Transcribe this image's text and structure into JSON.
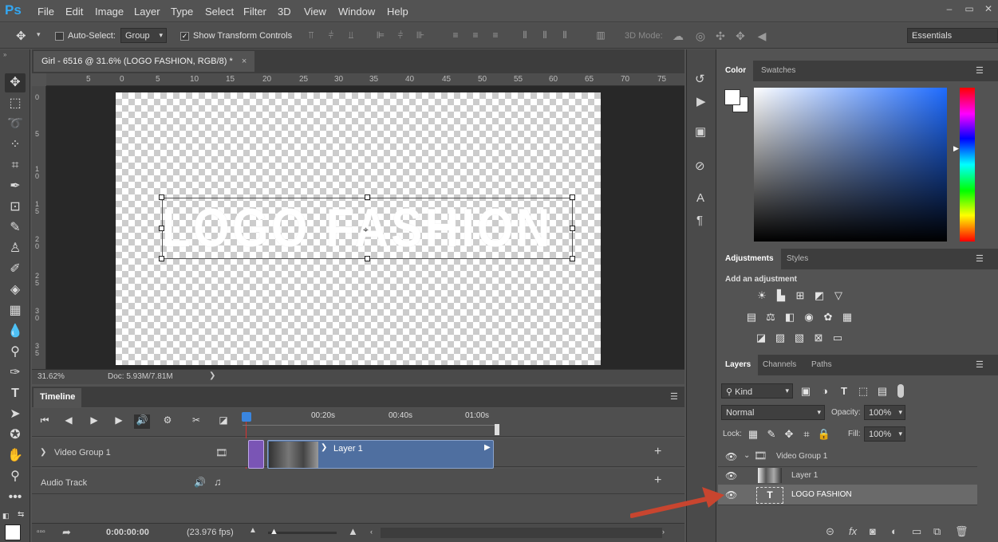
{
  "app": {
    "logo": "Ps"
  },
  "menu": [
    "File",
    "Edit",
    "Image",
    "Layer",
    "Type",
    "Select",
    "Filter",
    "3D",
    "View",
    "Window",
    "Help"
  ],
  "window_controls": [
    "–",
    "▭",
    "✕"
  ],
  "options": {
    "auto_select_label": "Auto-Select:",
    "auto_select_value": "Group",
    "show_transform_label": "Show Transform Controls",
    "mode_3d_label": "3D Mode:",
    "workspace": "Essentials"
  },
  "document": {
    "tab_title": "Girl - 6516 @ 31.6% (LOGO FASHION, RGB/8) *",
    "close": "×",
    "canvas_text": "LOGO FASHION"
  },
  "ruler": {
    "h_ticks": [
      "5",
      "0",
      "5",
      "10",
      "15",
      "20",
      "25",
      "30",
      "35",
      "40",
      "45",
      "50",
      "55",
      "60",
      "65",
      "70",
      "75"
    ],
    "v_ticks": [
      "0",
      "5",
      "1\n0",
      "1\n5",
      "2\n0",
      "2\n5",
      "3\n0",
      "3\n5"
    ]
  },
  "status": {
    "zoom": "31.62%",
    "doc": "Doc: 5.93M/7.81M",
    "arrow": "❯"
  },
  "timeline": {
    "tab": "Timeline",
    "times": [
      "00:20s",
      "00:40s",
      "01:00s"
    ],
    "current_time": "0:00:00:00",
    "fps": "(23.976 fps)",
    "tracks": [
      {
        "name": "Video Group 1"
      },
      {
        "name": "Audio Track"
      }
    ],
    "clip_label": "Layer 1"
  },
  "color_panel": {
    "tabs": [
      "Color",
      "Swatches"
    ],
    "fg": "#ffffff",
    "bg": "#ffffff"
  },
  "adjustments": {
    "tabs": [
      "Adjustments",
      "Styles"
    ],
    "add_label": "Add an adjustment"
  },
  "layers": {
    "tabs": [
      "Layers",
      "Channels",
      "Paths"
    ],
    "kind_label": "Kind",
    "blend_mode": "Normal",
    "opacity_label": "Opacity:",
    "opacity_value": "100%",
    "lock_label": "Lock:",
    "fill_label": "Fill:",
    "fill_value": "100%",
    "rows": [
      {
        "name": "Video Group 1"
      },
      {
        "name": "Layer 1"
      },
      {
        "name": "LOGO FASHION"
      }
    ]
  }
}
